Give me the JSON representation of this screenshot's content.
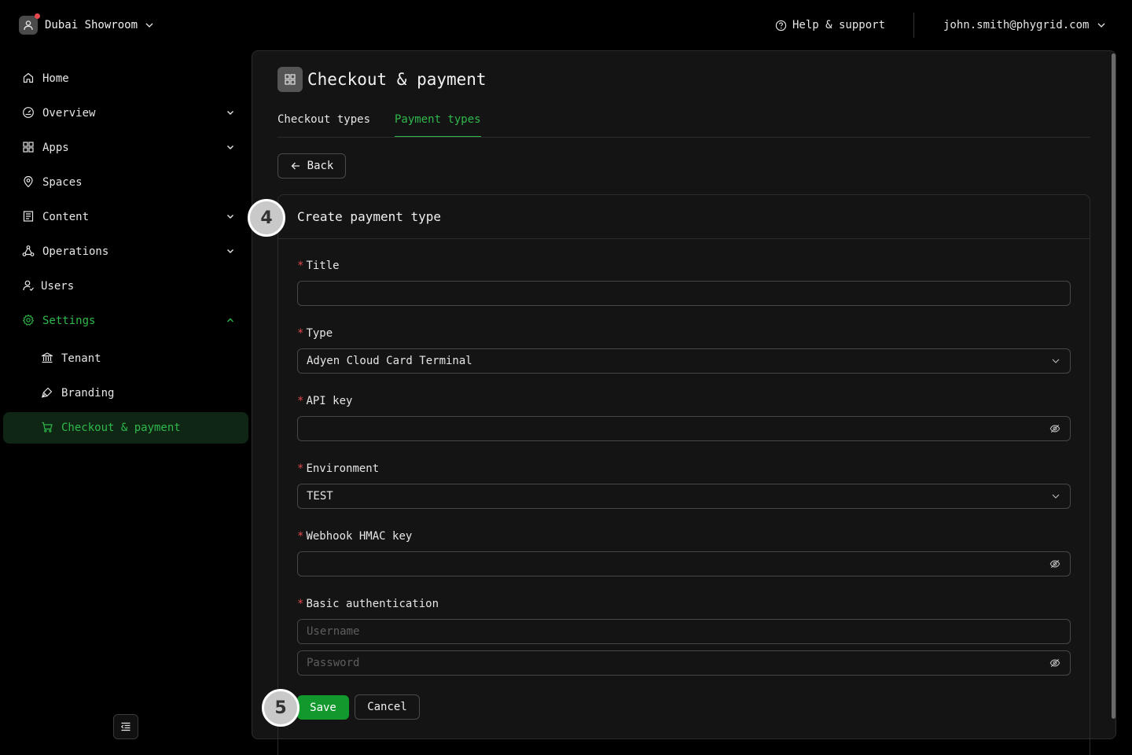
{
  "colors": {
    "accent": "#2eb84b",
    "save_button": "#11992e",
    "required": "#e5484d",
    "background": "#000000",
    "panel": "#141414"
  },
  "topbar": {
    "tenant_name": "Dubai Showroom",
    "help_label": "Help & support",
    "user_email": "john.smith@phygrid.com"
  },
  "sidebar": {
    "items": [
      {
        "label": "Home",
        "icon": "home-icon"
      },
      {
        "label": "Overview",
        "icon": "gauge-icon"
      },
      {
        "label": "Apps",
        "icon": "apps-grid-icon"
      },
      {
        "label": "Spaces",
        "icon": "location-pin-icon"
      },
      {
        "label": "Content",
        "icon": "content-icon"
      },
      {
        "label": "Operations",
        "icon": "operations-icon"
      },
      {
        "label": "Users",
        "icon": "users-icon"
      },
      {
        "label": "Settings",
        "icon": "gear-icon"
      }
    ],
    "settings_children": [
      {
        "label": "Tenant",
        "icon": "bank-icon"
      },
      {
        "label": "Branding",
        "icon": "brush-icon"
      },
      {
        "label": "Checkout & payment",
        "icon": "cart-icon"
      }
    ]
  },
  "page": {
    "title": "Checkout & payment",
    "tabs": [
      {
        "label": "Checkout types",
        "active": false
      },
      {
        "label": "Payment types",
        "active": true
      }
    ],
    "back_label": "Back"
  },
  "form": {
    "card_title": "Create payment type",
    "title_label": "Title",
    "title_value": "",
    "type_label": "Type",
    "type_value": "Adyen Cloud Card Terminal",
    "api_key_label": "API key",
    "environment_label": "Environment",
    "environment_value": "TEST",
    "hmac_label": "Webhook HMAC key",
    "basic_auth_label": "Basic authentication",
    "username_placeholder": "Username",
    "password_placeholder": "Password",
    "save_label": "Save",
    "cancel_label": "Cancel"
  },
  "annotations": {
    "step_form": "4",
    "step_save": "5"
  }
}
